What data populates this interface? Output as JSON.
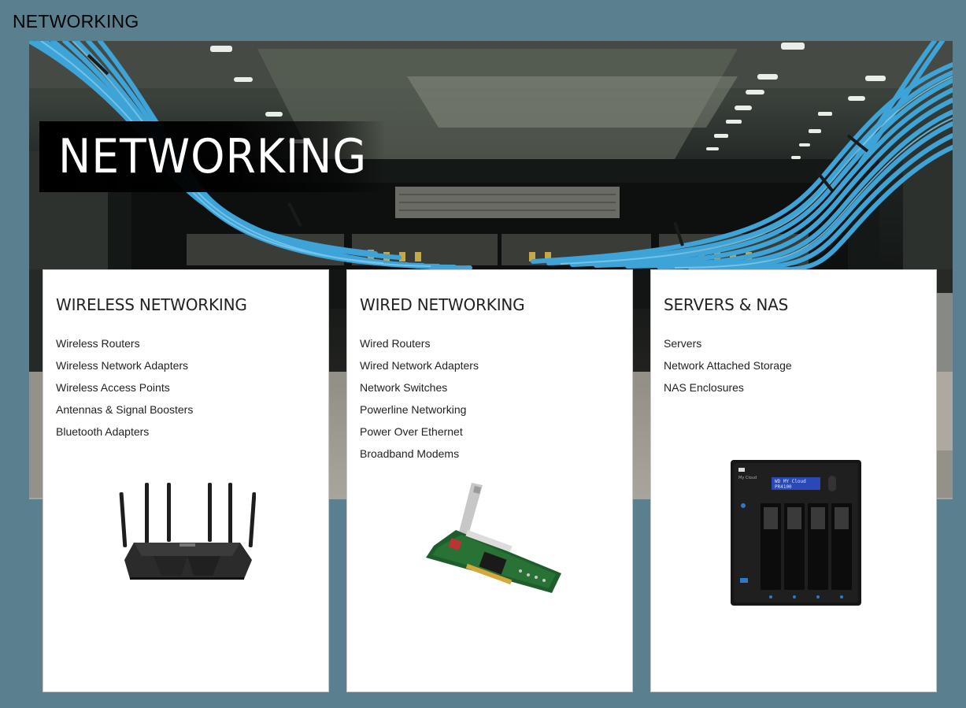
{
  "page": {
    "title": "NETWORKING"
  },
  "hero": {
    "banner_text": "NETWORKING",
    "image": "server-rack-cables"
  },
  "categories": [
    {
      "title": "WIRELESS NETWORKING",
      "links": [
        "Wireless Routers",
        "Wireless Network Adapters",
        "Wireless Access Points",
        "Antennas & Signal Boosters",
        "Bluetooth Adapters"
      ],
      "image": "wireless-router"
    },
    {
      "title": "WIRED NETWORKING",
      "links": [
        "Wired Routers",
        "Wired Network Adapters",
        "Network Switches",
        "Powerline Networking",
        "Power Over Ethernet",
        "Broadband Modems"
      ],
      "image": "network-card"
    },
    {
      "title": "SERVERS & NAS",
      "links": [
        "Servers",
        "Network Attached Storage",
        "NAS Enclosures"
      ],
      "image": "nas-device",
      "nas_display_text": "WD MY Cloud\nPR4100",
      "nas_brand": "WD"
    }
  ],
  "colors": {
    "page_background": "#5a7f8f",
    "card_background": "#ffffff",
    "cable_blue": "#3ea3d6",
    "banner_background": "#000000"
  }
}
